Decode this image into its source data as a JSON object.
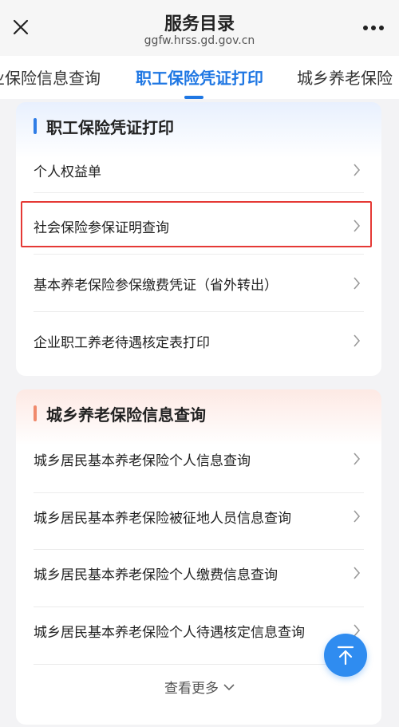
{
  "header": {
    "title": "服务目录",
    "subtitle": "ggfw.hrss.gd.gov.cn",
    "close_icon": "close-icon",
    "more_icon": "more-dots-icon"
  },
  "tabs": [
    {
      "label": "业保险信息查询",
      "active": false
    },
    {
      "label": "职工保险凭证打印",
      "active": true
    },
    {
      "label": "城乡养老保险",
      "active": false
    }
  ],
  "colors": {
    "accent_blue": "#1f77e3",
    "section_bar_blue": "#2f7de6",
    "section_bar_orange": "#f08a6c",
    "highlight_red": "#e53935"
  },
  "section1": {
    "title": "职工保险凭证打印",
    "items": [
      {
        "label": "个人权益单"
      },
      {
        "label": "社会保险参保证明查询"
      },
      {
        "label": "基本养老保险参保缴费凭证（省外转出）"
      },
      {
        "label": "企业职工养老待遇核定表打印"
      }
    ]
  },
  "section2": {
    "title": "城乡养老保险信息查询",
    "items": [
      {
        "label": "城乡居民基本养老保险个人信息查询"
      },
      {
        "label": "城乡居民基本养老保险被征地人员信息查询"
      },
      {
        "label": "城乡居民基本养老保险个人缴费信息查询"
      },
      {
        "label": "城乡居民基本养老保险个人待遇核定信息查询"
      }
    ],
    "view_more": "查看更多"
  },
  "fab_icon": "back-to-top-icon"
}
